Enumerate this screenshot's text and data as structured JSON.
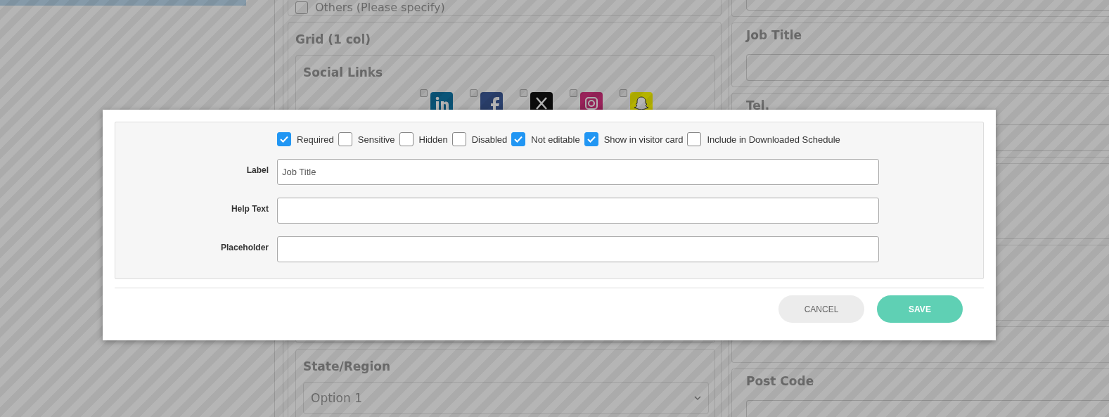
{
  "background": {
    "others_option": {
      "label": "Others (Please specify)",
      "checked": false
    },
    "grid_title": "Grid (1 col)",
    "social_links": {
      "title": "Social Links",
      "networks": [
        {
          "kind": "linkedin",
          "checked": false
        },
        {
          "kind": "facebook",
          "checked": false
        },
        {
          "kind": "x",
          "checked": false
        },
        {
          "kind": "instagram",
          "checked": false
        },
        {
          "kind": "snapchat",
          "checked": false
        }
      ]
    },
    "state_region": {
      "label": "State/Region",
      "value": "Option 1"
    },
    "right_fields": [
      {
        "label": "Job Title"
      },
      {
        "label": "Tel."
      },
      {
        "label": "Post Code"
      }
    ]
  },
  "dialog": {
    "flags": [
      {
        "label": "Required",
        "checked": true
      },
      {
        "label": "Sensitive",
        "checked": false
      },
      {
        "label": "Hidden",
        "checked": false
      },
      {
        "label": "Disabled",
        "checked": false
      },
      {
        "label": "Not editable",
        "checked": true
      },
      {
        "label": "Show in visitor card",
        "checked": true
      },
      {
        "label": "Include in Downloaded Schedule",
        "checked": false
      }
    ],
    "fields": [
      {
        "label": "Label",
        "value": "Job Title"
      },
      {
        "label": "Help Text"
      },
      {
        "label": "Placeholder"
      }
    ],
    "buttons": [
      {
        "kind": "cancel",
        "label": "CANCEL"
      },
      {
        "kind": "save",
        "label": "SAVE"
      }
    ]
  }
}
